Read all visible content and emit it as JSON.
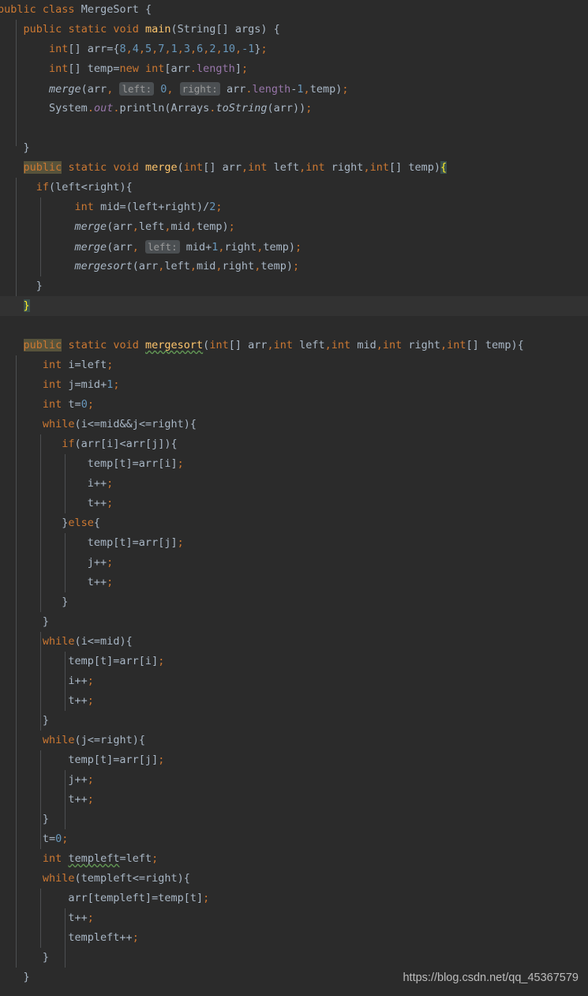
{
  "editor": {
    "language": "java",
    "theme": "darcula",
    "background_color": "#2b2b2b",
    "current_line_color": "#323232",
    "font_size_px": 13.5,
    "line_height_px": 25,
    "caret_line_index": 14,
    "colors": {
      "default_text": "#a9b7c6",
      "keyword": "#cc7832",
      "number": "#6897bb",
      "method": "#ffc66d",
      "field": "#9876aa",
      "semicolon": "#cc7832",
      "identifier_highlight_bg": "#57533b",
      "brace_match_bg": "#3b514d",
      "brace_match_fg": "#ffef28",
      "param_hint_bg": "#4b4f52",
      "param_hint_fg": "#9a9a9a",
      "warning_squiggle": "#629755",
      "indent_guide": "#4d4f51"
    }
  },
  "watermark": {
    "text": "https://blog.csdn.net/qq_45367579"
  },
  "code": {
    "class_name": "MergeSort",
    "lines": [
      {
        "i": 0,
        "indent": 0,
        "text": "public class MergeSort {"
      },
      {
        "i": 1,
        "indent": 1,
        "text": "public static void main(String[] args) {"
      },
      {
        "i": 2,
        "indent": 2,
        "text": "int[] arr={8,4,5,7,1,3,6,2,10,-1};"
      },
      {
        "i": 3,
        "indent": 2,
        "text": "int[] temp=new int[arr.length];"
      },
      {
        "i": 4,
        "indent": 2,
        "text": "merge(arr, left: 0, right: arr.length-1,temp);"
      },
      {
        "i": 5,
        "indent": 2,
        "text": "System.out.println(Arrays.toString(arr));"
      },
      {
        "i": 6,
        "indent": 0,
        "text": ""
      },
      {
        "i": 7,
        "indent": 1,
        "text": "}"
      },
      {
        "i": 8,
        "indent": 1,
        "text": "public static void merge(int[] arr,int left,int right,int[] temp){"
      },
      {
        "i": 9,
        "indent": 2,
        "text": "if(left<right){"
      },
      {
        "i": 10,
        "indent": 3,
        "text": "int mid=(left+right)/2;"
      },
      {
        "i": 11,
        "indent": 3,
        "text": "merge(arr,left,mid,temp);"
      },
      {
        "i": 12,
        "indent": 3,
        "text": "merge(arr, left: mid+1,right,temp);"
      },
      {
        "i": 13,
        "indent": 3,
        "text": "mergesort(arr,left,mid,right,temp);"
      },
      {
        "i": 14,
        "indent": 2,
        "text": "}"
      },
      {
        "i": 15,
        "indent": 1,
        "text": "}"
      },
      {
        "i": 16,
        "indent": 0,
        "text": ""
      },
      {
        "i": 17,
        "indent": 1,
        "text": "public static void mergesort(int[] arr,int left,int mid,int right,int[] temp){"
      },
      {
        "i": 18,
        "indent": 2,
        "text": "int i=left;"
      },
      {
        "i": 19,
        "indent": 2,
        "text": "int j=mid+1;"
      },
      {
        "i": 20,
        "indent": 2,
        "text": "int t=0;"
      },
      {
        "i": 21,
        "indent": 2,
        "text": "while(i<=mid&&j<=right){"
      },
      {
        "i": 22,
        "indent": 3,
        "text": "if(arr[i]<arr[j]){"
      },
      {
        "i": 23,
        "indent": 4,
        "text": "temp[t]=arr[i];"
      },
      {
        "i": 24,
        "indent": 4,
        "text": "i++;"
      },
      {
        "i": 25,
        "indent": 4,
        "text": "t++;"
      },
      {
        "i": 26,
        "indent": 3,
        "text": "}else{"
      },
      {
        "i": 27,
        "indent": 4,
        "text": "temp[t]=arr[j];"
      },
      {
        "i": 28,
        "indent": 4,
        "text": "j++;"
      },
      {
        "i": 29,
        "indent": 4,
        "text": "t++;"
      },
      {
        "i": 30,
        "indent": 3,
        "text": "}"
      },
      {
        "i": 31,
        "indent": 2,
        "text": "}"
      },
      {
        "i": 32,
        "indent": 2,
        "text": "while(i<=mid){"
      },
      {
        "i": 33,
        "indent": 3,
        "text": "temp[t]=arr[i];"
      },
      {
        "i": 34,
        "indent": 3,
        "text": "i++;"
      },
      {
        "i": 35,
        "indent": 3,
        "text": "t++;"
      },
      {
        "i": 36,
        "indent": 2,
        "text": "}"
      },
      {
        "i": 37,
        "indent": 2,
        "text": "while(j<=right){"
      },
      {
        "i": 38,
        "indent": 3,
        "text": "temp[t]=arr[j];"
      },
      {
        "i": 39,
        "indent": 3,
        "text": "j++;"
      },
      {
        "i": 40,
        "indent": 3,
        "text": "t++;"
      },
      {
        "i": 41,
        "indent": 2,
        "text": "}"
      },
      {
        "i": 42,
        "indent": 2,
        "text": "t=0;"
      },
      {
        "i": 43,
        "indent": 2,
        "text": "int templeft=left;"
      },
      {
        "i": 44,
        "indent": 2,
        "text": "while(templeft<=right){"
      },
      {
        "i": 45,
        "indent": 3,
        "text": "arr[templeft]=temp[t];"
      },
      {
        "i": 46,
        "indent": 3,
        "text": "t++;"
      },
      {
        "i": 47,
        "indent": 3,
        "text": "templeft++;"
      },
      {
        "i": 48,
        "indent": 2,
        "text": "}"
      },
      {
        "i": 49,
        "indent": 1,
        "text": "}"
      }
    ],
    "parameter_hints": [
      {
        "line": 4,
        "label": "left:"
      },
      {
        "line": 4,
        "label": "right:"
      },
      {
        "line": 12,
        "label": "left:"
      }
    ],
    "warnings": [
      {
        "line": 17,
        "symbol": "mergesort"
      },
      {
        "line": 43,
        "symbol": "templeft"
      }
    ],
    "highlighted_identifier": "public",
    "matched_braces": [
      {
        "line": 8,
        "char": "{"
      },
      {
        "line": 15,
        "char": "}"
      }
    ]
  }
}
